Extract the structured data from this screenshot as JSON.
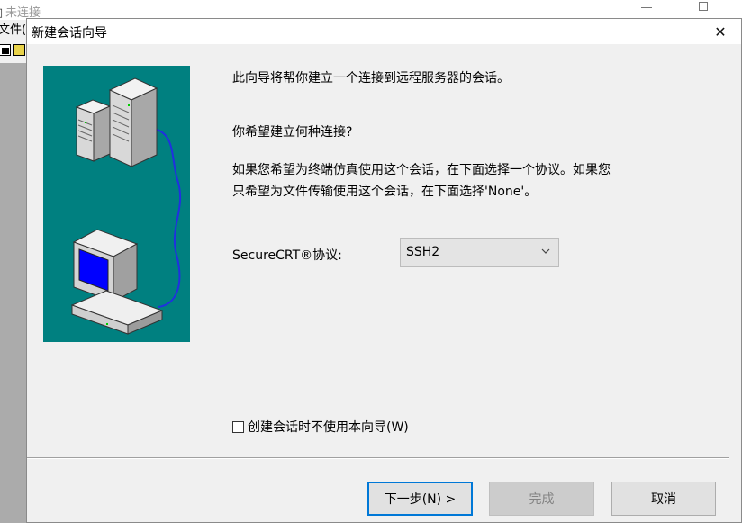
{
  "background_window": {
    "title": "未连接",
    "menu_file": "文件(",
    "toolbar_text": "💾"
  },
  "dialog": {
    "title": "新建会话向导",
    "close_glyph": "✕",
    "intro": "此向导将帮你建立一个连接到远程服务器的会话。",
    "question": "你希望建立何种连接?",
    "description_line1": "如果您希望为终端仿真使用这个会话，在下面选择一个协议。如果您",
    "description_line2": "只希望为文件传输使用这个会话，在下面选择'None'。",
    "protocol_label": "SecureCRT®协议:",
    "protocol_value": "SSH2",
    "no_wizard_label": "创建会话时不使用本向导(W)",
    "no_wizard_checked": false,
    "buttons": {
      "next": "下一步(N) >",
      "finish": "完成",
      "cancel": "取消"
    }
  },
  "colors": {
    "illustration_bg": "#008080",
    "focus_border": "#0078d7",
    "screen_blue": "#0000ff"
  },
  "icons": [
    "server-icon",
    "computer-icon",
    "cable-icon",
    "chevron-down-icon",
    "close-icon"
  ]
}
